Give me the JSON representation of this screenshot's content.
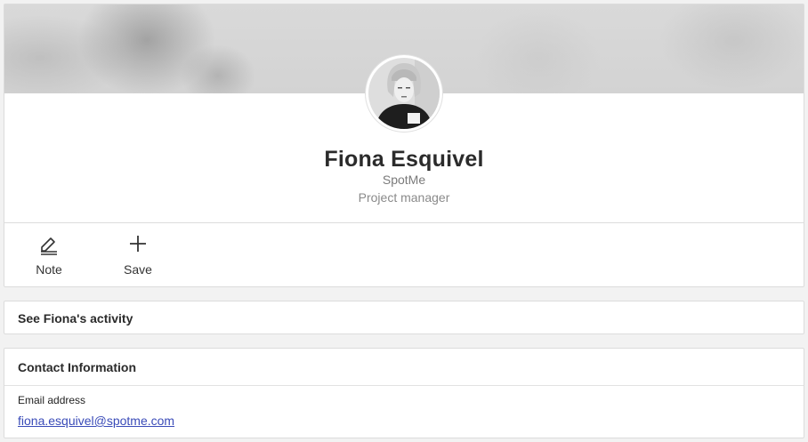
{
  "profile": {
    "name": "Fiona Esquivel",
    "company": "SpotMe",
    "role": "Project manager"
  },
  "actions": [
    {
      "label": "Note",
      "icon": "pencil-icon"
    },
    {
      "label": "Save",
      "icon": "plus-icon"
    }
  ],
  "activity": {
    "title": "See Fiona's activity"
  },
  "contact": {
    "title": "Contact Information",
    "email_label": "Email address",
    "email_value": "fiona.esquivel@spotme.com"
  }
}
